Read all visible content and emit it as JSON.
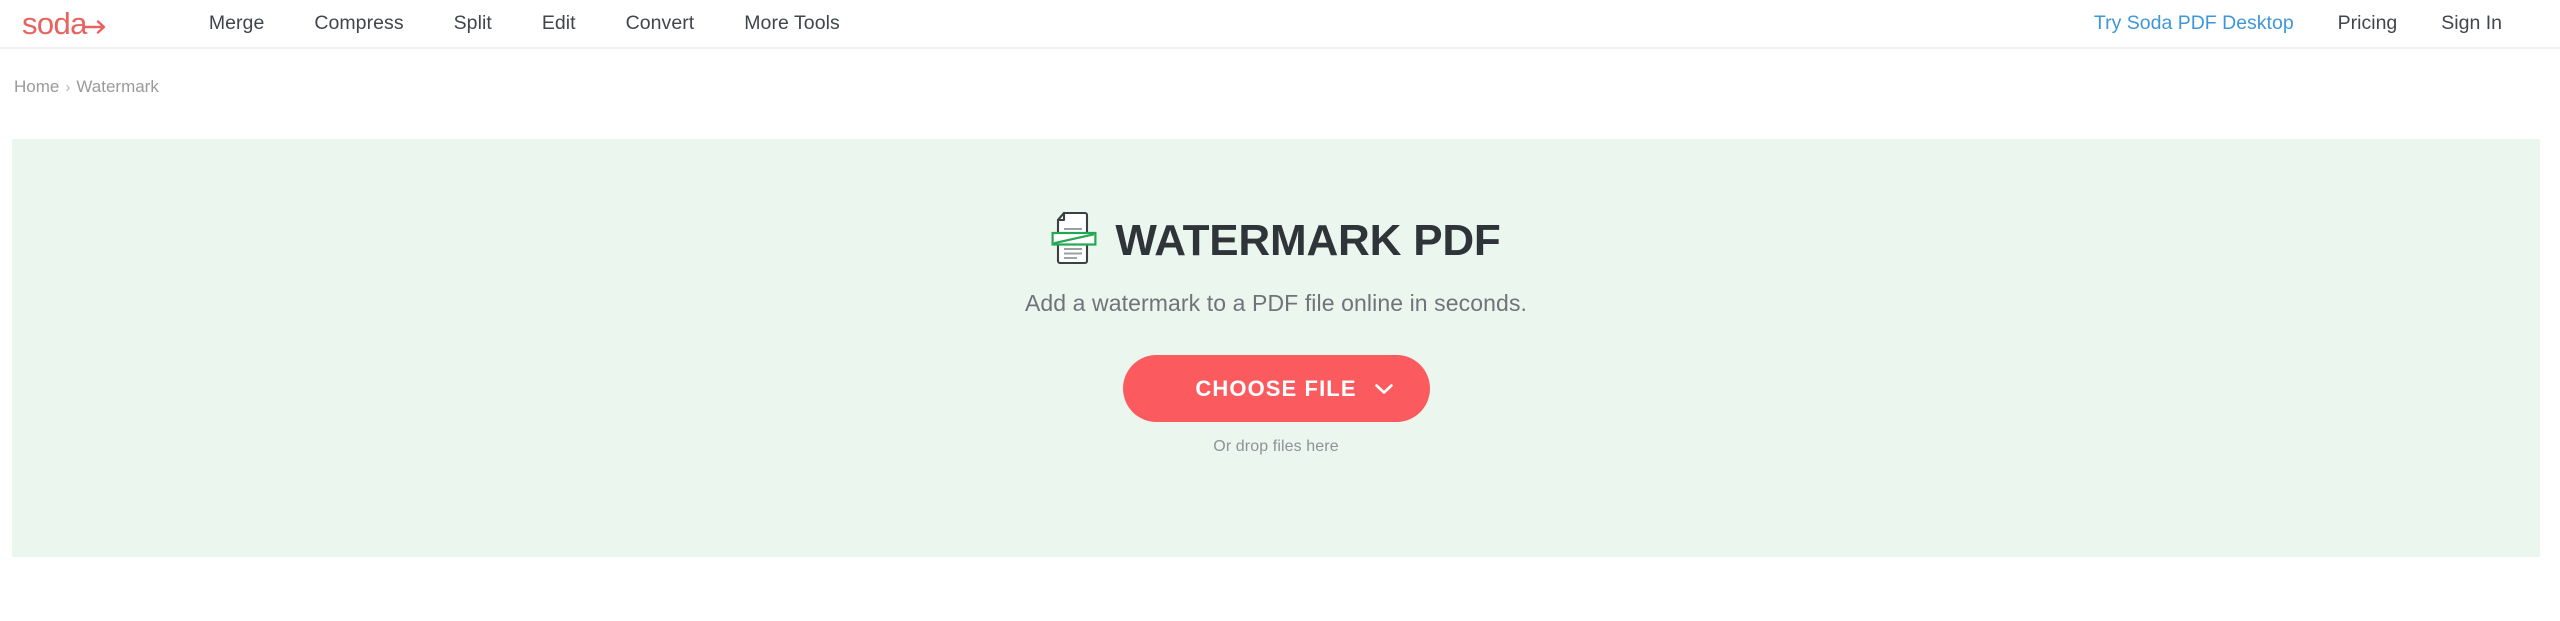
{
  "header": {
    "logo": {
      "text": "soda",
      "icon": "arrow-right-icon",
      "color": "#e8625f"
    },
    "nav_primary": [
      {
        "label": "Merge"
      },
      {
        "label": "Compress"
      },
      {
        "label": "Split"
      },
      {
        "label": "Edit"
      },
      {
        "label": "Convert"
      },
      {
        "label": "More Tools"
      }
    ],
    "nav_right": {
      "desktop_link": "Try Soda PDF Desktop",
      "desktop_link_color": "#3f97d8",
      "pricing": "Pricing",
      "sign_in": "Sign In"
    }
  },
  "breadcrumb": {
    "home": "Home",
    "separator": "›",
    "current": "Watermark"
  },
  "hero": {
    "icon": "watermark-document-icon",
    "title": "WATERMARK PDF",
    "subtitle": "Add a watermark to a PDF file online in seconds.",
    "cta_label": "CHOOSE FILE",
    "cta_icon": "chevron-down-icon",
    "cta_color": "#fb5b5e",
    "drop_hint": "Or drop files here",
    "background_color": "#eaf6ee"
  }
}
